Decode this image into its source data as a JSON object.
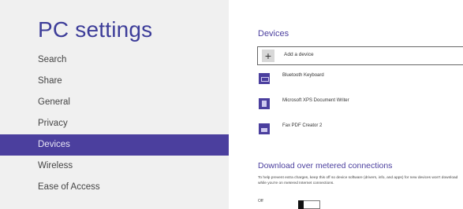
{
  "sidebar": {
    "title": "PC settings",
    "items": [
      {
        "label": "Search"
      },
      {
        "label": "Share"
      },
      {
        "label": "General"
      },
      {
        "label": "Privacy"
      },
      {
        "label": "Devices",
        "active": true
      },
      {
        "label": "Wireless"
      },
      {
        "label": "Ease of Access"
      }
    ]
  },
  "devices": {
    "section_title": "Devices",
    "add_label": "Add a device",
    "list": [
      {
        "name": "Bluetooth Keyboard",
        "icon": "keyboard-icon"
      },
      {
        "name": "Microsoft XPS Document Writer",
        "icon": "document-icon"
      },
      {
        "name": "Fax PDF Creator 2",
        "icon": "printer-icon"
      }
    ]
  },
  "metered": {
    "title": "Download over metered connections",
    "description": "To help prevent extra charges, keep this off so device software (drivers, info, and apps) for new devices won't download while you're on metered Internet connections.",
    "toggle_label": "Off",
    "toggle_on": false
  },
  "colors": {
    "accent": "#4b3f9e",
    "sidebar_bg": "#f0f0f0"
  }
}
